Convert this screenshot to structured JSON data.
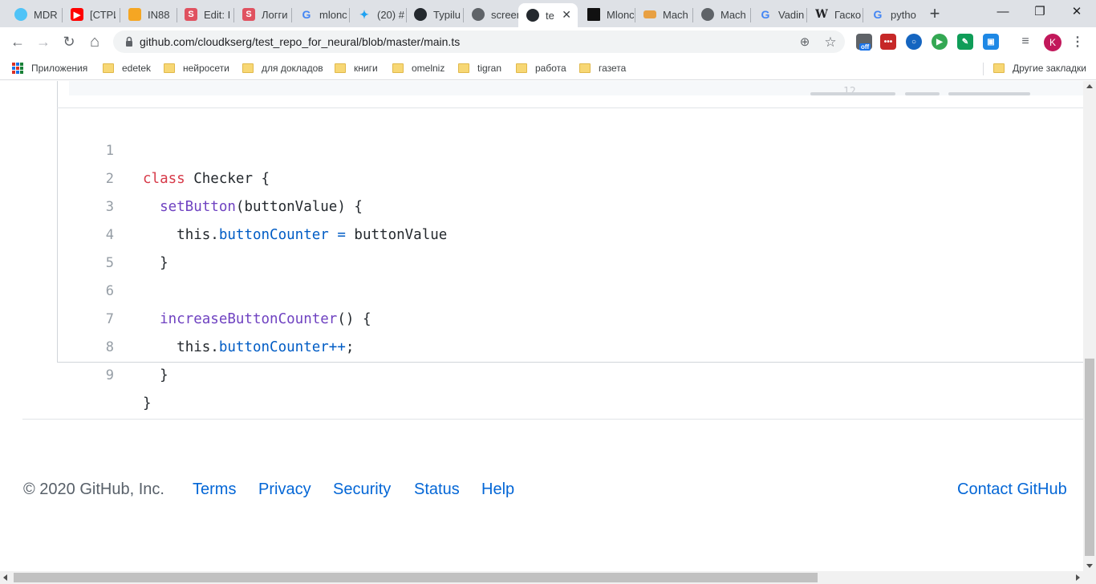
{
  "browser": {
    "tabs": [
      {
        "title": "MDR",
        "icon": "cloud-icon"
      },
      {
        "title": "[СТРИ",
        "icon": "youtube-icon"
      },
      {
        "title": "IN88",
        "icon": "box-icon"
      },
      {
        "title": "Edit: I",
        "icon": "s-icon"
      },
      {
        "title": "Логги",
        "icon": "s-icon"
      },
      {
        "title": "mlonc",
        "icon": "google-icon"
      },
      {
        "title": "(20) #",
        "icon": "twitter-icon"
      },
      {
        "title": "Typilu",
        "icon": "github-icon"
      },
      {
        "title": "screen",
        "icon": "globe-icon"
      },
      {
        "title": "te",
        "icon": "github-icon",
        "active": true
      },
      {
        "title": "Mlonc",
        "icon": "chart-icon"
      },
      {
        "title": "Mach",
        "icon": "ruler-icon"
      },
      {
        "title": "Mach",
        "icon": "globe-icon"
      },
      {
        "title": "Vadin",
        "icon": "google-icon"
      },
      {
        "title": "Гаско",
        "icon": "wikipedia-icon"
      },
      {
        "title": "pytho",
        "icon": "google-icon"
      }
    ],
    "new_tab_symbol": "+",
    "window_controls": {
      "minimize": "—",
      "maximize": "❐",
      "close": "✕"
    },
    "nav": {
      "back": "←",
      "forward": "→",
      "reload": "↻",
      "home": "⌂"
    },
    "url": "github.com/cloudkserg/test_repo_for_neural/blob/master/main.ts",
    "zoom_symbol": "⊕",
    "star_symbol": "☆",
    "profile_initial": "K",
    "extension_off_label": "off"
  },
  "bookmarks": {
    "apps_label": "Приложения",
    "items": [
      "edetek",
      "нейросети",
      "для докладов",
      "книги",
      "omelniz",
      "tigran",
      "работа",
      "газета"
    ],
    "other_label": "Другие закладки"
  },
  "page": {
    "remnant_number": "12",
    "code_lines": [
      {
        "num": "1"
      },
      {
        "num": "2"
      },
      {
        "num": "3"
      },
      {
        "num": "4"
      },
      {
        "num": "5"
      },
      {
        "num": "6"
      },
      {
        "num": "7"
      },
      {
        "num": "8"
      },
      {
        "num": "9"
      }
    ],
    "code": {
      "l1_kw": "class",
      "l1_rest": " Checker {",
      "l2_indent": "  ",
      "l2_fn": "setButton",
      "l2_rest": "(buttonValue) {",
      "l3_indent": "    ",
      "l3_this": "this.",
      "l3_prop": "buttonCounter",
      "l3_op": " = ",
      "l3_val": "buttonValue",
      "l4": "  }",
      "l5": "",
      "l6_indent": "  ",
      "l6_fn": "increaseButtonCounter",
      "l6_rest": "() {",
      "l7_indent": "    ",
      "l7_this": "this.",
      "l7_prop": "buttonCounter++",
      "l7_rest": ";",
      "l8": "  }",
      "l9": "}"
    },
    "footer": {
      "copyright": "© 2020 GitHub, Inc.",
      "links": [
        "Terms",
        "Privacy",
        "Security",
        "Status",
        "Help"
      ],
      "contact": "Contact GitHub"
    }
  },
  "colors": {
    "keyword": "#d73a49",
    "function": "#6f42c1",
    "property": "#005cc5",
    "link": "#0366d6"
  }
}
